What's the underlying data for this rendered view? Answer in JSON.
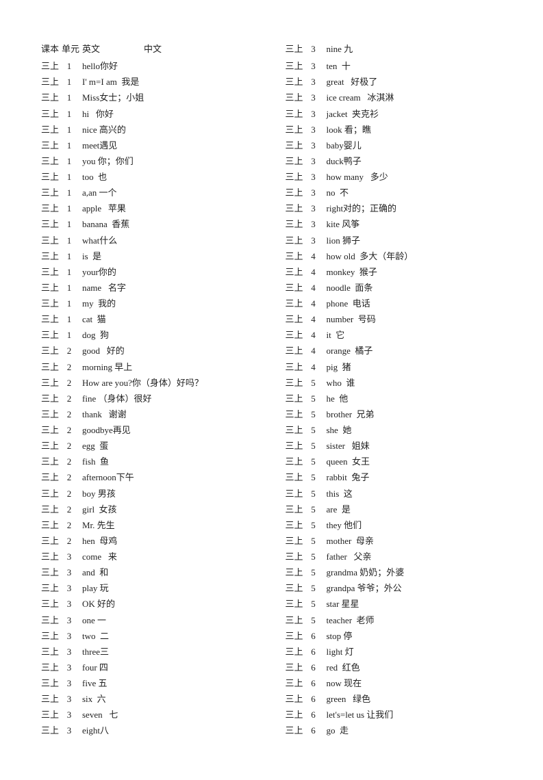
{
  "leftCol": {
    "header": {
      "book": "课本",
      "updown": "单元",
      "unit": "",
      "en": "英文",
      "zh": "中文"
    },
    "rows": [
      {
        "book": "三上",
        "unit": "1",
        "en": "hello你好",
        "zh": ""
      },
      {
        "book": "三上",
        "unit": "1",
        "en": "I'm=I am",
        "zh": "我是"
      },
      {
        "book": "三上",
        "unit": "1",
        "en": "Miss女士；小姐",
        "zh": ""
      },
      {
        "book": "三上",
        "unit": "1",
        "en": "hi  你好",
        "zh": ""
      },
      {
        "book": "三上",
        "unit": "1",
        "en": "nice 高兴的",
        "zh": ""
      },
      {
        "book": "三上",
        "unit": "1",
        "en": "meet遇见",
        "zh": ""
      },
      {
        "book": "三上",
        "unit": "1",
        "en": "you 你；你们",
        "zh": ""
      },
      {
        "book": "三上",
        "unit": "1",
        "en": "too  也",
        "zh": ""
      },
      {
        "book": "三上",
        "unit": "1",
        "en": "a,an 一个",
        "zh": ""
      },
      {
        "book": "三上",
        "unit": "1",
        "en": "apple   苹果",
        "zh": ""
      },
      {
        "book": "三上",
        "unit": "1",
        "en": "banana  香蕉",
        "zh": ""
      },
      {
        "book": "三上",
        "unit": "1",
        "en": "what什么",
        "zh": ""
      },
      {
        "book": "三上",
        "unit": "1",
        "en": "is  是",
        "zh": ""
      },
      {
        "book": "三上",
        "unit": "1",
        "en": "your你的",
        "zh": ""
      },
      {
        "book": "三上",
        "unit": "1",
        "en": "name   名字",
        "zh": ""
      },
      {
        "book": "三上",
        "unit": "1",
        "en": "my 我的",
        "zh": ""
      },
      {
        "book": "三上",
        "unit": "1",
        "en": "cat  猫",
        "zh": ""
      },
      {
        "book": "三上",
        "unit": "1",
        "en": "dog  狗",
        "zh": ""
      },
      {
        "book": "三上",
        "unit": "2",
        "en": "good   好的",
        "zh": ""
      },
      {
        "book": "三上",
        "unit": "2",
        "en": "morning 早上",
        "zh": ""
      },
      {
        "book": "三上",
        "unit": "2",
        "en": "How are you?你（身体）好吗？",
        "zh": ""
      },
      {
        "book": "三上",
        "unit": "2",
        "en": "fine （身体）很好",
        "zh": ""
      },
      {
        "book": "三上",
        "unit": "2",
        "en": "thank   谢谢",
        "zh": ""
      },
      {
        "book": "三上",
        "unit": "2",
        "en": "goodbye再见",
        "zh": ""
      },
      {
        "book": "三上",
        "unit": "2",
        "en": "egg  蛋",
        "zh": ""
      },
      {
        "book": "三上",
        "unit": "2",
        "en": "fish  鱼",
        "zh": ""
      },
      {
        "book": "三上",
        "unit": "2",
        "en": "afternoon下午",
        "zh": ""
      },
      {
        "book": "三上",
        "unit": "2",
        "en": "boy 男孩",
        "zh": ""
      },
      {
        "book": "三上",
        "unit": "2",
        "en": "girl  女孩",
        "zh": ""
      },
      {
        "book": "三上",
        "unit": "2",
        "en": "Mr. 先生",
        "zh": ""
      },
      {
        "book": "三上",
        "unit": "2",
        "en": "hen  母鸡",
        "zh": ""
      },
      {
        "book": "三上",
        "unit": "3",
        "en": "come   来",
        "zh": ""
      },
      {
        "book": "三上",
        "unit": "3",
        "en": "and  和",
        "zh": ""
      },
      {
        "book": "三上",
        "unit": "3",
        "en": "play 玩",
        "zh": ""
      },
      {
        "book": "三上",
        "unit": "3",
        "en": "OK 好的",
        "zh": ""
      },
      {
        "book": "三上",
        "unit": "3",
        "en": "one 一",
        "zh": ""
      },
      {
        "book": "三上",
        "unit": "3",
        "en": "two  二",
        "zh": ""
      },
      {
        "book": "三上",
        "unit": "3",
        "en": "three三",
        "zh": ""
      },
      {
        "book": "三上",
        "unit": "3",
        "en": "four 四",
        "zh": ""
      },
      {
        "book": "三上",
        "unit": "3",
        "en": "five 五",
        "zh": ""
      },
      {
        "book": "三上",
        "unit": "3",
        "en": "six  六",
        "zh": ""
      },
      {
        "book": "三上",
        "unit": "3",
        "en": "seven   七",
        "zh": ""
      },
      {
        "book": "三上",
        "unit": "3",
        "en": "eight八",
        "zh": ""
      }
    ]
  },
  "rightCol": {
    "header": {
      "book": "三上",
      "unit": "3",
      "en": "nine 九",
      "zh": ""
    },
    "rows": [
      {
        "book": "三上",
        "unit": "3",
        "en": "ten  十",
        "zh": ""
      },
      {
        "book": "三上",
        "unit": "3",
        "en": "great   好极了",
        "zh": ""
      },
      {
        "book": "三上",
        "unit": "3",
        "en": "ice cream   冰淇淋",
        "zh": ""
      },
      {
        "book": "三上",
        "unit": "3",
        "en": "jacket  夹克衫",
        "zh": ""
      },
      {
        "book": "三上",
        "unit": "3",
        "en": "look 看；瞧",
        "zh": ""
      },
      {
        "book": "三上",
        "unit": "3",
        "en": "baby婴儿",
        "zh": ""
      },
      {
        "book": "三上",
        "unit": "3",
        "en": "duck鸭子",
        "zh": ""
      },
      {
        "book": "三上",
        "unit": "3",
        "en": "how many   多少",
        "zh": ""
      },
      {
        "book": "三上",
        "unit": "3",
        "en": "no  不",
        "zh": ""
      },
      {
        "book": "三上",
        "unit": "3",
        "en": "right对的；正确的",
        "zh": ""
      },
      {
        "book": "三上",
        "unit": "3",
        "en": "kite 风筝",
        "zh": ""
      },
      {
        "book": "三上",
        "unit": "3",
        "en": "lion 狮子",
        "zh": ""
      },
      {
        "book": "三上",
        "unit": "4",
        "en": "how old  多大（年龄）",
        "zh": ""
      },
      {
        "book": "三上",
        "unit": "4",
        "en": "monkey  猴子",
        "zh": ""
      },
      {
        "book": "三上",
        "unit": "4",
        "en": "noodle  面条",
        "zh": ""
      },
      {
        "book": "三上",
        "unit": "4",
        "en": "phone  电话",
        "zh": ""
      },
      {
        "book": "三上",
        "unit": "4",
        "en": "number  号码",
        "zh": ""
      },
      {
        "book": "三上",
        "unit": "4",
        "en": "it  它",
        "zh": ""
      },
      {
        "book": "三上",
        "unit": "4",
        "en": "orange  橘子",
        "zh": ""
      },
      {
        "book": "三上",
        "unit": "4",
        "en": "pig  猪",
        "zh": ""
      },
      {
        "book": "三上",
        "unit": "5",
        "en": "who  谁",
        "zh": ""
      },
      {
        "book": "三上",
        "unit": "5",
        "en": "he  他",
        "zh": ""
      },
      {
        "book": "三上",
        "unit": "5",
        "en": "brother  兄弟",
        "zh": ""
      },
      {
        "book": "三上",
        "unit": "5",
        "en": "she  她",
        "zh": ""
      },
      {
        "book": "三上",
        "unit": "5",
        "en": "sister   姐妹",
        "zh": ""
      },
      {
        "book": "三上",
        "unit": "5",
        "en": "queen  女王",
        "zh": ""
      },
      {
        "book": "三上",
        "unit": "5",
        "en": "rabbit  兔子",
        "zh": ""
      },
      {
        "book": "三上",
        "unit": "5",
        "en": "this  这",
        "zh": ""
      },
      {
        "book": "三上",
        "unit": "5",
        "en": "are  是",
        "zh": ""
      },
      {
        "book": "三上",
        "unit": "5",
        "en": "they 他们",
        "zh": ""
      },
      {
        "book": "三上",
        "unit": "5",
        "en": "mother  母亲",
        "zh": ""
      },
      {
        "book": "三上",
        "unit": "5",
        "en": "father   父亲",
        "zh": ""
      },
      {
        "book": "三上",
        "unit": "5",
        "en": "grandma 奶奶；外婆",
        "zh": ""
      },
      {
        "book": "三上",
        "unit": "5",
        "en": "grandpa 爷爷；外公",
        "zh": ""
      },
      {
        "book": "三上",
        "unit": "5",
        "en": "star 星星",
        "zh": ""
      },
      {
        "book": "三上",
        "unit": "5",
        "en": "teacher  老师",
        "zh": ""
      },
      {
        "book": "三上",
        "unit": "6",
        "en": "stop 停",
        "zh": ""
      },
      {
        "book": "三上",
        "unit": "6",
        "en": "light 灯",
        "zh": ""
      },
      {
        "book": "三上",
        "unit": "6",
        "en": "red  红色",
        "zh": ""
      },
      {
        "book": "三上",
        "unit": "6",
        "en": "now 现在",
        "zh": ""
      },
      {
        "book": "三上",
        "unit": "6",
        "en": "green   绿色",
        "zh": ""
      },
      {
        "book": "三上",
        "unit": "6",
        "en": "let's=let us 让我们",
        "zh": ""
      },
      {
        "book": "三上",
        "unit": "6",
        "en": "go  走",
        "zh": ""
      }
    ]
  }
}
